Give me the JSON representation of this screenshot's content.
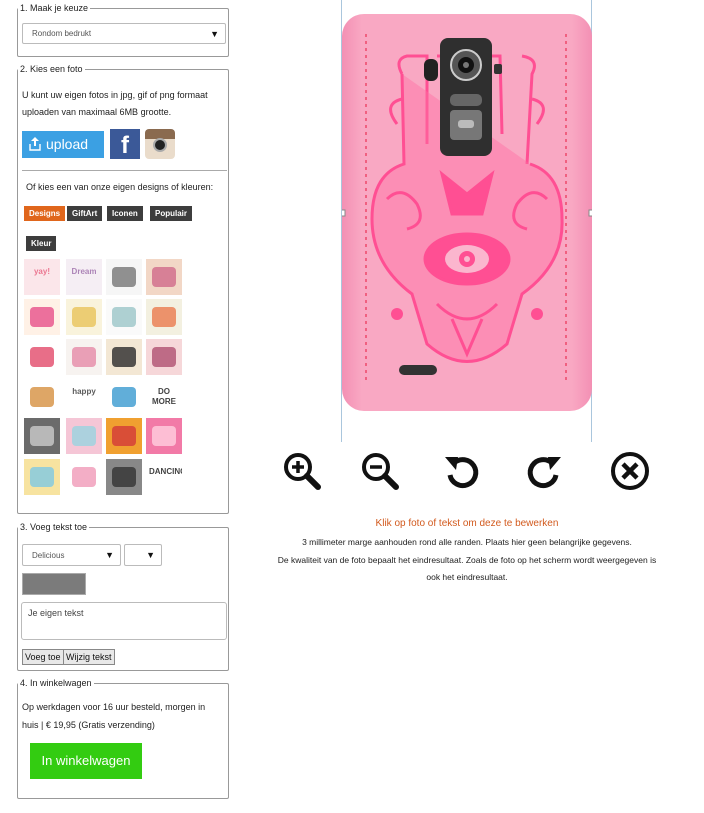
{
  "step1": {
    "legend": "1. Maak je keuze",
    "select_value": "Rondom bedrukt"
  },
  "step2": {
    "legend": "2. Kies een foto",
    "intro_line1": "U kunt uw eigen fotos in jpg, gif of png formaat",
    "intro_line2": "uploaden van maximaal 6MB grootte.",
    "upload_label": "upload",
    "facebook_label": "f",
    "or_text": "Of kies een van onze eigen designs of kleuren:",
    "tabs": [
      "Designs",
      "GiftArt",
      "Iconen",
      "Populair",
      "Kleur"
    ],
    "thumbnails": [
      {
        "name": "yay",
        "bg": "#fbe6ea",
        "text": "yay!",
        "color": "#e85a7a"
      },
      {
        "name": "dream-believe",
        "bg": "#f5eef4",
        "text": "Dream",
        "color": "#9b6aa8"
      },
      {
        "name": "deer",
        "bg": "#f6f6f6",
        "text": "",
        "color": "#777"
      },
      {
        "name": "donuts",
        "bg": "#f2d7c6",
        "text": "",
        "color": "#d06a8a"
      },
      {
        "name": "flowers-colorful",
        "bg": "#fff1e6",
        "text": "",
        "color": "#e7508a"
      },
      {
        "name": "triangles-pastel",
        "bg": "#f9f3dc",
        "text": "",
        "color": "#e9c35a"
      },
      {
        "name": "feathers",
        "bg": "#fafafa",
        "text": "",
        "color": "#9bc6c8"
      },
      {
        "name": "icecream",
        "bg": "#f3f0e0",
        "text": "",
        "color": "#ea7b4e"
      },
      {
        "name": "world-map",
        "bg": "#fff",
        "text": "",
        "color": "#e24a6a"
      },
      {
        "name": "quote-text",
        "bg": "#f7f3f0",
        "text": "",
        "color": "#e58aa8"
      },
      {
        "name": "aztec",
        "bg": "#f3e7d4",
        "text": "",
        "color": "#2a2a2a"
      },
      {
        "name": "script-pink",
        "bg": "#f6d7d9",
        "text": "",
        "color": "#b05070"
      },
      {
        "name": "animals",
        "bg": "#fff",
        "text": "",
        "color": "#d69040"
      },
      {
        "name": "happy-days",
        "bg": "#fff",
        "text": "happy",
        "color": "#333"
      },
      {
        "name": "triangles-color",
        "bg": "#fff",
        "text": "",
        "color": "#3a9ad0"
      },
      {
        "name": "do-more",
        "bg": "#fff",
        "text": "DO MORE",
        "color": "#111"
      },
      {
        "name": "tiger",
        "bg": "#6b6b6b",
        "text": "",
        "color": "#ccc"
      },
      {
        "name": "chevron-pastel",
        "bg": "#f5c6d6",
        "text": "",
        "color": "#9ad3e0"
      },
      {
        "name": "cubes",
        "bg": "#f0a030",
        "text": "",
        "color": "#d33a3a"
      },
      {
        "name": "pink-geo",
        "bg": "#f27aa7",
        "text": "",
        "color": "#ffd0e0"
      },
      {
        "name": "pastel-squares",
        "bg": "#f7e3a0",
        "text": "",
        "color": "#7ec8e3"
      },
      {
        "name": "script-stripes",
        "bg": "#fff",
        "text": "",
        "color": "#f09ab8"
      },
      {
        "name": "bw-portrait",
        "bg": "#888",
        "text": "",
        "color": "#333"
      },
      {
        "name": "dancing",
        "bg": "#fff",
        "text": "DANCING",
        "color": "#111"
      }
    ]
  },
  "step3": {
    "legend": "3. Voeg tekst toe",
    "font_value": "Delicious",
    "size_value": "",
    "text_placeholder": "Je eigen tekst",
    "add_label": "Voeg toe",
    "edit_label": "Wijzig tekst"
  },
  "step4": {
    "legend": "4. In winkelwagen",
    "delivery_line1": "Op werkdagen voor 16 uur besteld, morgen in",
    "delivery_line2": "huis | € 19,95 (Gratis verzending)",
    "cart_label": "In winkelwagen"
  },
  "preview": {
    "phone_color": "#f9a8c3",
    "design_color": "#ff4f93",
    "tools": [
      {
        "name": "zoom-in-icon"
      },
      {
        "name": "zoom-out-icon"
      },
      {
        "name": "rotate-left-icon"
      },
      {
        "name": "rotate-right-icon"
      },
      {
        "name": "delete-icon"
      }
    ],
    "click_hint": "Klik op foto of tekst om deze te bewerken",
    "info_line1": "3 millimeter marge aanhouden rond alle randen. Plaats hier geen belangrijke gegevens.",
    "info_line2": "De kwaliteit van de foto bepaalt het eindresultaat. Zoals de foto op het scherm wordt weergegeven is",
    "info_line3": "ook het eindresultaat."
  },
  "colors": {
    "accent_orange": "#e0661c",
    "cart_green": "#33cc11",
    "upload_blue": "#3ba0e3"
  }
}
